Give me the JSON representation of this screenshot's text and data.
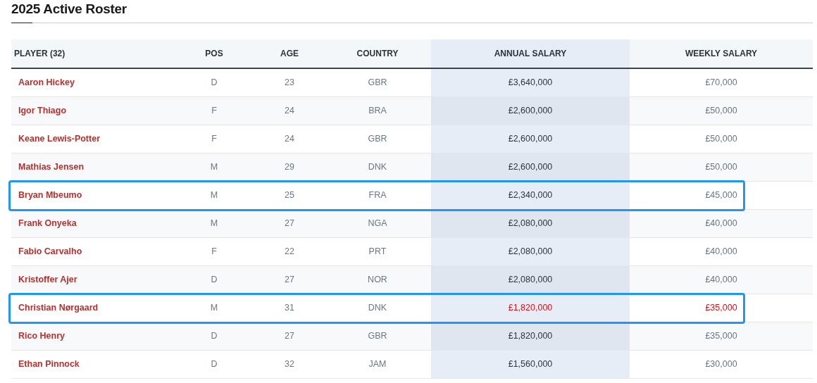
{
  "title": "2025 Active Roster",
  "table": {
    "columns": [
      "PLAYER (32)",
      "POS",
      "AGE",
      "COUNTRY",
      "ANNUAL SALARY",
      "WEEKLY SALARY"
    ],
    "rows": [
      {
        "player": "Aaron Hickey",
        "pos": "D",
        "age": "23",
        "country": "GBR",
        "annual": "£3,640,000",
        "weekly": "£70,000",
        "outlined": false,
        "salary_red": false
      },
      {
        "player": "Igor Thiago",
        "pos": "F",
        "age": "24",
        "country": "BRA",
        "annual": "£2,600,000",
        "weekly": "£50,000",
        "outlined": false,
        "salary_red": false
      },
      {
        "player": "Keane Lewis-Potter",
        "pos": "F",
        "age": "24",
        "country": "GBR",
        "annual": "£2,600,000",
        "weekly": "£50,000",
        "outlined": false,
        "salary_red": false
      },
      {
        "player": "Mathias Jensen",
        "pos": "M",
        "age": "29",
        "country": "DNK",
        "annual": "£2,600,000",
        "weekly": "£50,000",
        "outlined": false,
        "salary_red": false
      },
      {
        "player": "Bryan Mbeumo",
        "pos": "M",
        "age": "25",
        "country": "FRA",
        "annual": "£2,340,000",
        "weekly": "£45,000",
        "outlined": true,
        "salary_red": false
      },
      {
        "player": "Frank Onyeka",
        "pos": "M",
        "age": "27",
        "country": "NGA",
        "annual": "£2,080,000",
        "weekly": "£40,000",
        "outlined": false,
        "salary_red": false
      },
      {
        "player": "Fabio Carvalho",
        "pos": "F",
        "age": "22",
        "country": "PRT",
        "annual": "£2,080,000",
        "weekly": "£40,000",
        "outlined": false,
        "salary_red": false
      },
      {
        "player": "Kristoffer Ajer",
        "pos": "D",
        "age": "27",
        "country": "NOR",
        "annual": "£2,080,000",
        "weekly": "£40,000",
        "outlined": false,
        "salary_red": false
      },
      {
        "player": "Christian Nørgaard",
        "pos": "M",
        "age": "31",
        "country": "DNK",
        "annual": "£1,820,000",
        "weekly": "£35,000",
        "outlined": true,
        "salary_red": true
      },
      {
        "player": "Rico Henry",
        "pos": "D",
        "age": "27",
        "country": "GBR",
        "annual": "£1,820,000",
        "weekly": "£35,000",
        "outlined": false,
        "salary_red": false
      },
      {
        "player": "Ethan Pinnock",
        "pos": "D",
        "age": "32",
        "country": "JAM",
        "annual": "£1,560,000",
        "weekly": "£30,000",
        "outlined": false,
        "salary_red": false
      }
    ]
  }
}
